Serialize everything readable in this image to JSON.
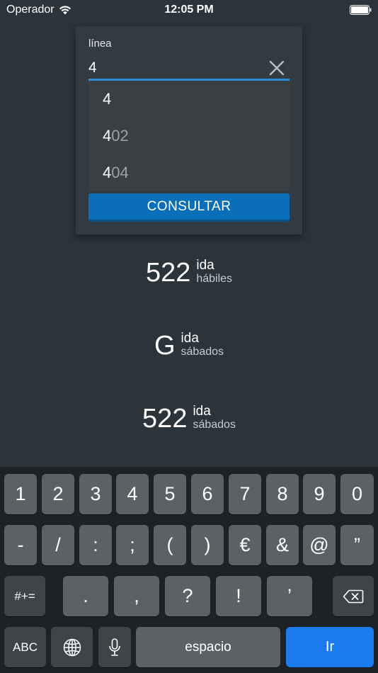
{
  "status_bar": {
    "carrier": "Operador",
    "time": "12:05 PM"
  },
  "search": {
    "label": "línea",
    "value": "4",
    "suggestions": [
      {
        "match": "4",
        "rest": ""
      },
      {
        "match": "4",
        "rest": "02"
      },
      {
        "match": "4",
        "rest": "04"
      }
    ],
    "submit_label": "CONSULTAR"
  },
  "routes": [
    {
      "number": "522",
      "direction": "ida",
      "day": "hábiles"
    },
    {
      "number": "G",
      "direction": "ida",
      "day": "sábados"
    },
    {
      "number": "522",
      "direction": "ida",
      "day": "sábados"
    }
  ],
  "keyboard": {
    "row1": [
      "1",
      "2",
      "3",
      "4",
      "5",
      "6",
      "7",
      "8",
      "9",
      "0"
    ],
    "row2": [
      "-",
      "/",
      ":",
      ";",
      "(",
      ")",
      "€",
      "&",
      "@",
      "”"
    ],
    "row3": {
      "shift_label": "#+=",
      "keys": [
        ".",
        ",",
        "?",
        "!",
        "’"
      ]
    },
    "row4": {
      "abc_label": "ABC",
      "space_label": "espacio",
      "go_label": "Ir"
    }
  },
  "colors": {
    "background": "#2b333b",
    "accent": "#2a8fd8",
    "button": "#0b6eb8",
    "go_key": "#1d7bf0"
  }
}
